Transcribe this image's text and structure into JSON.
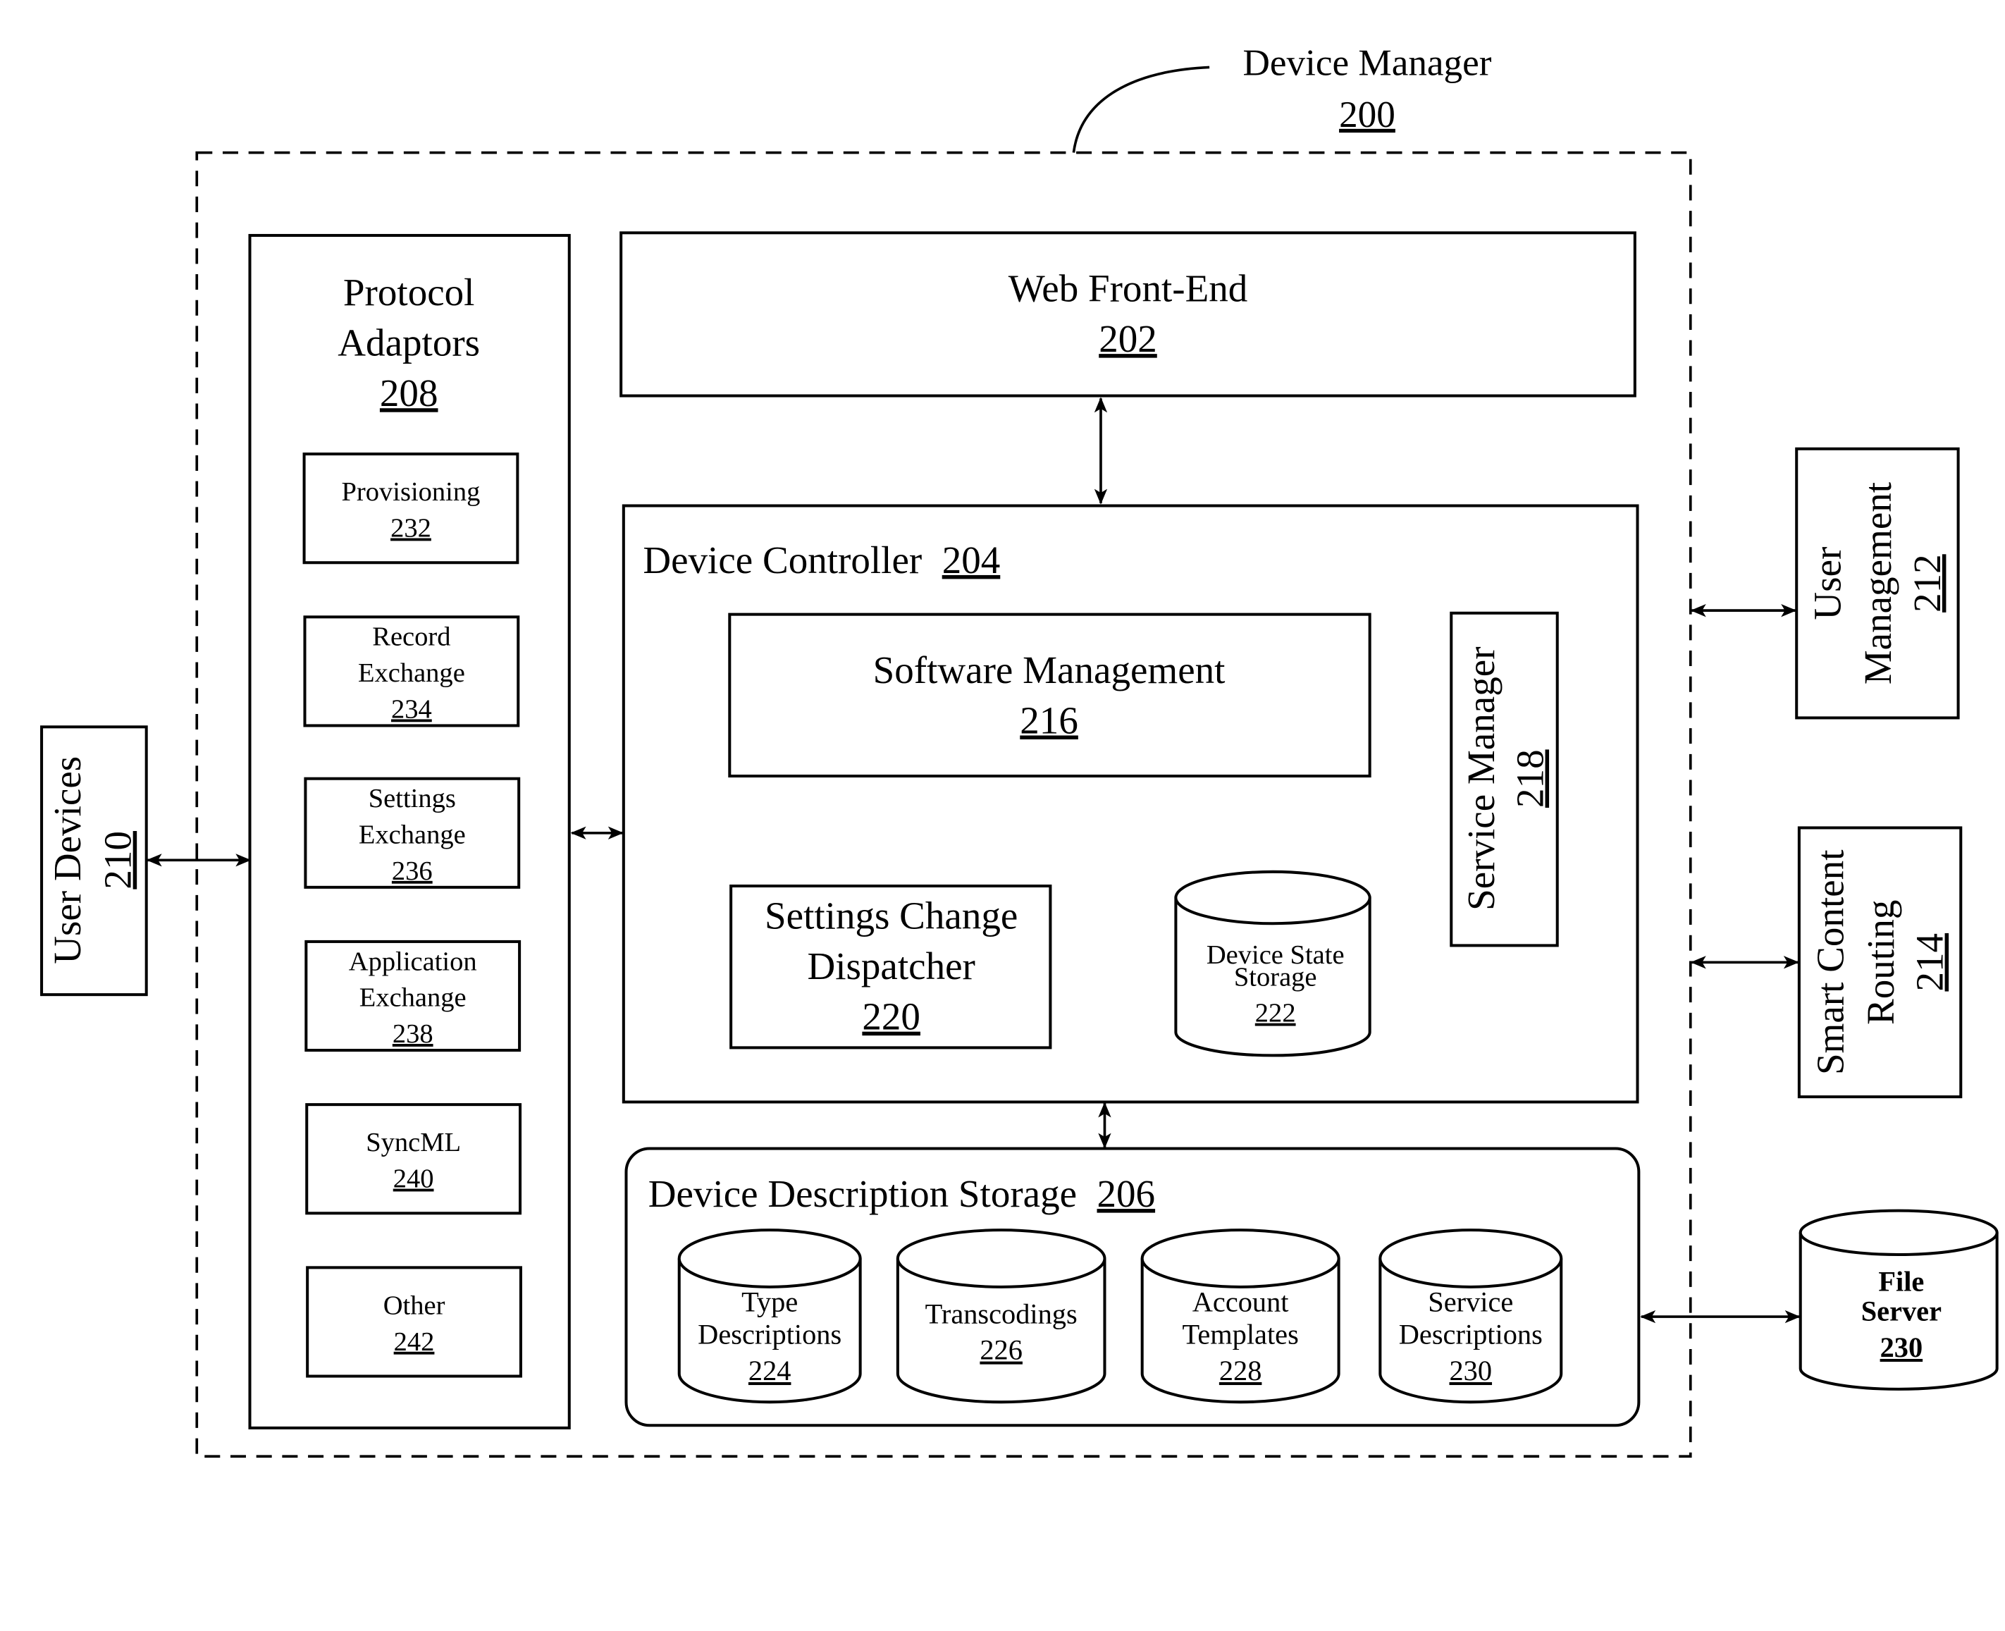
{
  "diagram": {
    "title": {
      "label": "Device Manager",
      "ref": "200"
    },
    "components": {
      "web_front_end": {
        "label": "Web Front-End",
        "ref": "202"
      },
      "device_controller": {
        "label": "Device Controller",
        "ref": "204"
      },
      "software_management": {
        "label": "Software Management",
        "ref": "216"
      },
      "service_manager": {
        "label": "Service Manager",
        "ref": "218"
      },
      "settings_change_dispatcher": {
        "lines": [
          "Settings Change",
          "Dispatcher"
        ],
        "ref": "220"
      },
      "device_state_storage": {
        "lines": [
          "Device State",
          "Storage"
        ],
        "ref": "222"
      },
      "device_description_storage": {
        "label": "Device Description Storage",
        "ref": "206"
      },
      "protocol_adaptors": {
        "lines": [
          "Protocol",
          "Adaptors"
        ],
        "ref": "208"
      },
      "user_devices": {
        "label": "User Devices",
        "ref": "210"
      },
      "user_management": {
        "lines": [
          "User",
          "Management"
        ],
        "ref": "212"
      },
      "smart_content_routing": {
        "lines": [
          "Smart Content",
          "Routing"
        ],
        "ref": "214"
      },
      "file_server": {
        "lines": [
          "File",
          "Server"
        ],
        "ref": "230"
      }
    },
    "adaptors": [
      {
        "lines": [
          "Provisioning"
        ],
        "ref": "232"
      },
      {
        "lines": [
          "Record",
          "Exchange"
        ],
        "ref": "234"
      },
      {
        "lines": [
          "Settings",
          "Exchange"
        ],
        "ref": "236"
      },
      {
        "lines": [
          "Application",
          "Exchange"
        ],
        "ref": "238"
      },
      {
        "lines": [
          "SyncML"
        ],
        "ref": "240"
      },
      {
        "lines": [
          "Other"
        ],
        "ref": "242"
      }
    ],
    "storages": [
      {
        "lines": [
          "Type",
          "Descriptions"
        ],
        "ref": "224"
      },
      {
        "lines": [
          "Transcodings"
        ],
        "ref": "226"
      },
      {
        "lines": [
          "Account",
          "Templates"
        ],
        "ref": "228"
      },
      {
        "lines": [
          "Service",
          "Descriptions"
        ],
        "ref": "230"
      }
    ],
    "connections": [
      {
        "from": "Web Front-End",
        "to": "Device Controller",
        "type": "bidirectional"
      },
      {
        "from": "Device Controller",
        "to": "Device Description Storage",
        "type": "bidirectional"
      },
      {
        "from": "Protocol Adaptors",
        "to": "Device Controller",
        "type": "bidirectional"
      },
      {
        "from": "User Devices",
        "to": "Protocol Adaptors",
        "type": "bidirectional"
      },
      {
        "from": "Device Manager",
        "to": "User Management",
        "type": "bidirectional"
      },
      {
        "from": "Device Manager",
        "to": "Smart Content Routing",
        "type": "bidirectional"
      },
      {
        "from": "Device Description Storage",
        "to": "File Server",
        "type": "bidirectional"
      }
    ]
  }
}
